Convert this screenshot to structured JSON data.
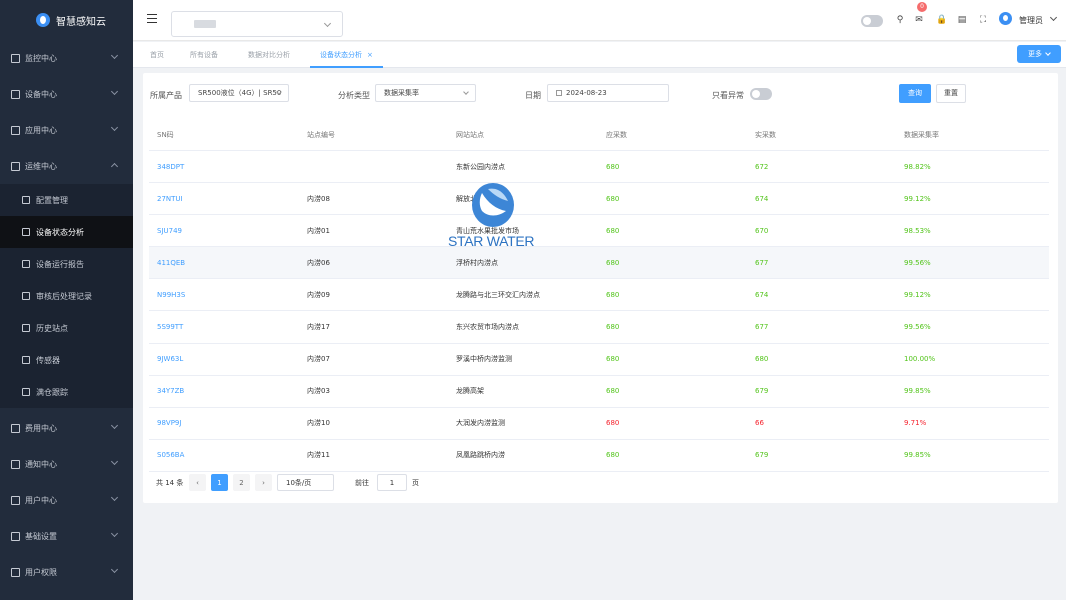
{
  "app": {
    "name": "智慧感知云"
  },
  "sidebar": {
    "items": [
      {
        "label": "监控中心"
      },
      {
        "label": "设备中心"
      },
      {
        "label": "应用中心"
      },
      {
        "label": "运维中心"
      },
      {
        "label": "费用中心"
      },
      {
        "label": "通知中心"
      },
      {
        "label": "用户中心"
      },
      {
        "label": "基础设置"
      },
      {
        "label": "用户权限"
      }
    ],
    "subitems": [
      {
        "label": "配置管理"
      },
      {
        "label": "设备状态分析"
      },
      {
        "label": "设备运行报告"
      },
      {
        "label": "审核后处理记录"
      },
      {
        "label": "历史站点"
      },
      {
        "label": "传感器"
      },
      {
        "label": "满仓跟踪"
      }
    ]
  },
  "topbar": {
    "notification_count": "0",
    "user_name": "管理员"
  },
  "tabs": [
    {
      "label": "首页"
    },
    {
      "label": "所有设备"
    },
    {
      "label": "数据对比分析"
    },
    {
      "label": "设备状态分析",
      "close": "×"
    }
  ],
  "more_button": "更多",
  "filters": {
    "product_label": "所属产品",
    "product_value": "SR500液位（4G）| SR50",
    "analysis_label": "分析类型",
    "analysis_value": "数据采集率",
    "date_label": "日期",
    "date_value": "2024-08-23",
    "abnormal_label": "只看异常",
    "query_button": "查询",
    "reset_button": "重置"
  },
  "table": {
    "headers": [
      "SN码",
      "站点编号",
      "网站站点",
      "应采数",
      "实采数",
      "数据采集率"
    ],
    "rows": [
      {
        "sn": "348DPT",
        "code": "",
        "site": "东新公园内涝点",
        "expected": "680",
        "actual": "672",
        "rate": "98.82%",
        "status": "ok",
        "highlight": false
      },
      {
        "sn": "27NTUI",
        "code": "内涝08",
        "site": "解放北路内涝点",
        "expected": "680",
        "actual": "674",
        "rate": "99.12%",
        "status": "ok",
        "highlight": false
      },
      {
        "sn": "SJU749",
        "code": "内涝01",
        "site": "青山荒水果批发市场",
        "expected": "680",
        "actual": "670",
        "rate": "98.53%",
        "status": "ok",
        "highlight": false
      },
      {
        "sn": "411QEB",
        "code": "内涝06",
        "site": "浮桥村内涝点",
        "expected": "680",
        "actual": "677",
        "rate": "99.56%",
        "status": "ok",
        "highlight": true
      },
      {
        "sn": "N99H3S",
        "code": "内涝09",
        "site": "龙腾路与北三环交汇内涝点",
        "expected": "680",
        "actual": "674",
        "rate": "99.12%",
        "status": "ok",
        "highlight": false
      },
      {
        "sn": "5S99TT",
        "code": "内涝17",
        "site": "东兴农贸市场内涝点",
        "expected": "680",
        "actual": "677",
        "rate": "99.56%",
        "status": "ok",
        "highlight": false
      },
      {
        "sn": "9JW63L",
        "code": "内涝07",
        "site": "罗溪中桥内涝监测",
        "expected": "680",
        "actual": "680",
        "rate": "100.00%",
        "status": "ok",
        "highlight": false
      },
      {
        "sn": "34Y7ZB",
        "code": "内涝03",
        "site": "龙腾高架",
        "expected": "680",
        "actual": "679",
        "rate": "99.85%",
        "status": "ok",
        "highlight": false
      },
      {
        "sn": "98VP9J",
        "code": "内涝10",
        "site": "大润发内涝监测",
        "expected": "680",
        "actual": "66",
        "rate": "9.71%",
        "status": "bad",
        "highlight": false
      },
      {
        "sn": "S056BA",
        "code": "内涝11",
        "site": "凤凰路跳桥内涝",
        "expected": "680",
        "actual": "679",
        "rate": "99.85%",
        "status": "ok",
        "highlight": false
      }
    ]
  },
  "watermark": {
    "text": "STAR WATER"
  },
  "pagination": {
    "total": "共 14 条",
    "prev": "‹",
    "pages": [
      "1",
      "2"
    ],
    "next": "›",
    "page_size": "10条/页",
    "goto_label": "前往",
    "goto_value": "1",
    "goto_suffix": "页"
  },
  "colors": {
    "sidebar_bg": "#222c3c",
    "accent": "#409eff",
    "ok": "#52c41a",
    "bad": "#f5222d"
  }
}
